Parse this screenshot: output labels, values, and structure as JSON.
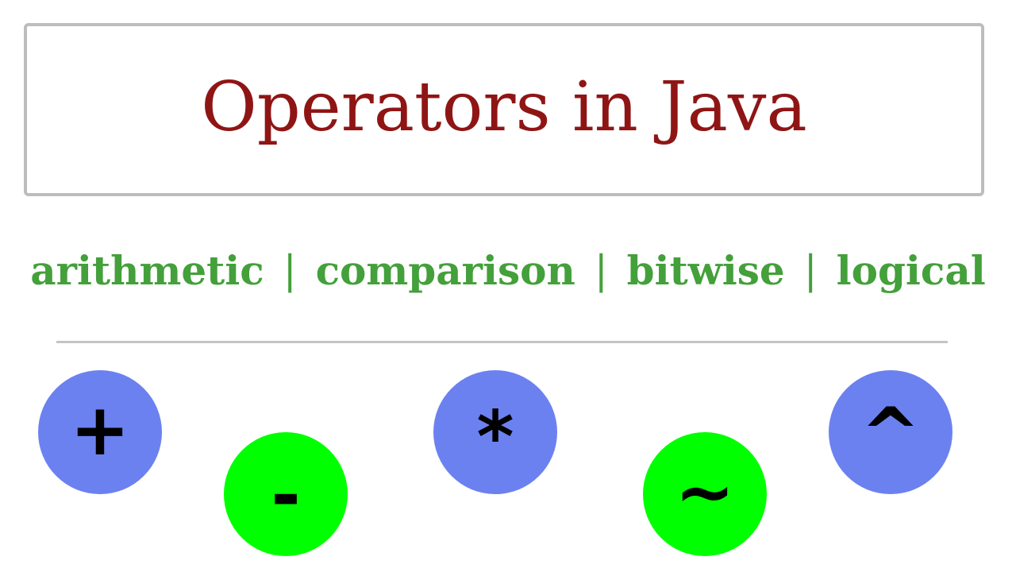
{
  "title": "Operators in Java",
  "categories": {
    "items": [
      "arithmetic",
      "comparison",
      "bitwise",
      "logical"
    ],
    "separator": "|"
  },
  "operators": [
    {
      "symbol": "+",
      "color": "#6c81f0",
      "icon": "plus-icon"
    },
    {
      "symbol": "-",
      "color": "#00ff00",
      "icon": "minus-icon"
    },
    {
      "symbol": "*",
      "color": "#6c81f0",
      "icon": "asterisk-icon"
    },
    {
      "symbol": "~",
      "color": "#00ff00",
      "icon": "tilde-icon"
    },
    {
      "symbol": "^",
      "color": "#6c81f0",
      "icon": "caret-icon"
    }
  ],
  "colors": {
    "title": "#8f1515",
    "categories": "#43a03a",
    "border": "#bdbdbd",
    "blue_circle": "#6c81f0",
    "green_circle": "#00ff00"
  }
}
